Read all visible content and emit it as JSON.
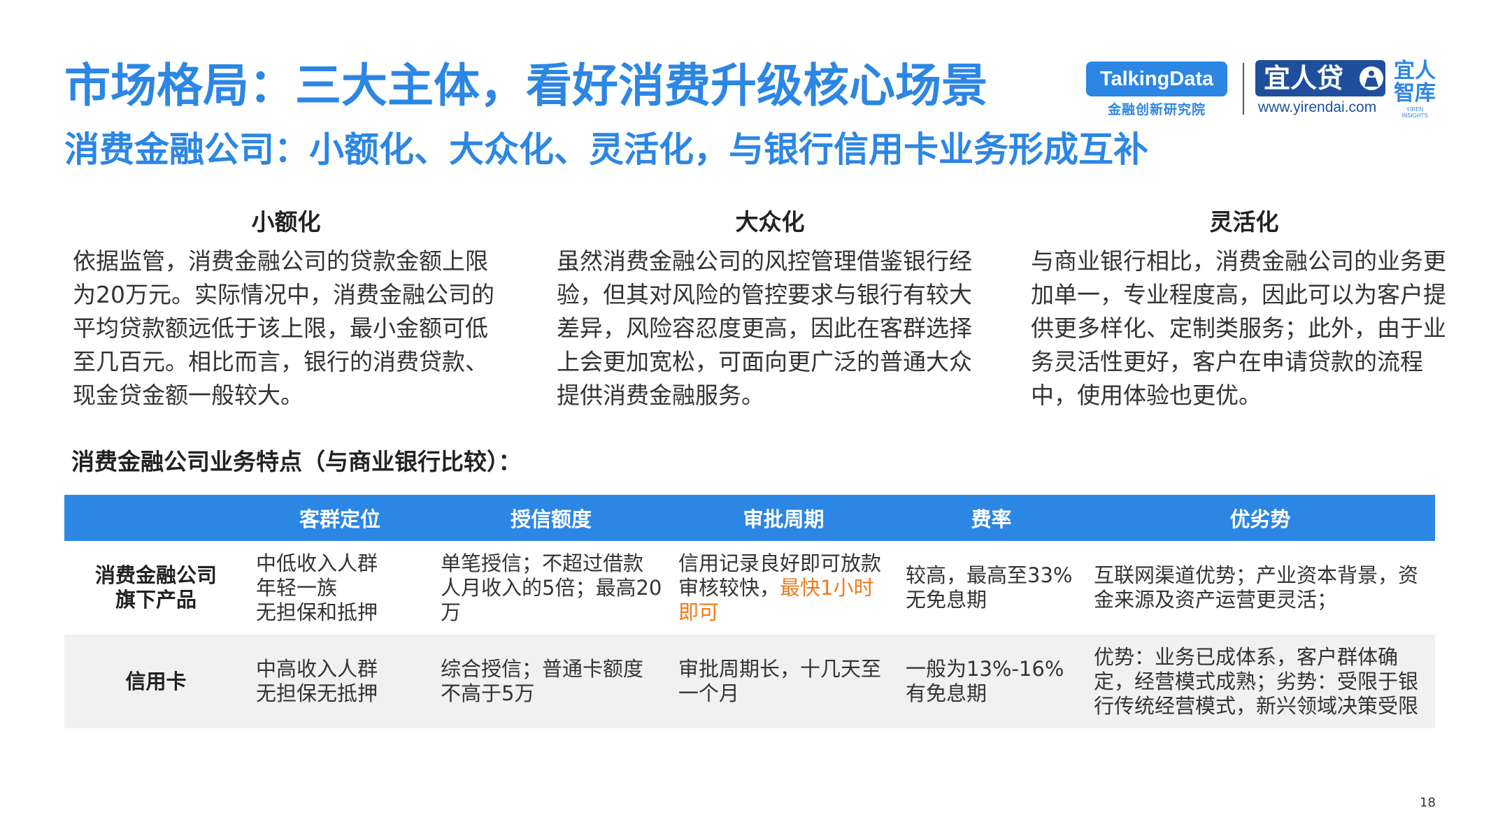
{
  "header": {
    "title": "市场格局：三大主体，看好消费升级核心场景",
    "subtitle": "消费金融公司：小额化、大众化、灵活化，与银行信用卡业务形成互补"
  },
  "logos": {
    "talkingdata": {
      "name": "TalkingData",
      "sub": "金融创新研究院"
    },
    "yirendai": {
      "name": "宜人贷",
      "url": "www.yirendai.com",
      "brand_line1": "宜人",
      "brand_line2": "智库",
      "brand_en_line1": "YIREN",
      "brand_en_line2": "INSIGHTS"
    }
  },
  "columns": [
    {
      "heading": "小额化",
      "body": "依据监管，消费金融公司的贷款金额上限为20万元。实际情况中，消费金融公司的平均贷款额远低于该上限，最小金额可低至几百元。相比而言，银行的消费贷款、现金贷金额一般较大。"
    },
    {
      "heading": "大众化",
      "body": "虽然消费金融公司的风控管理借鉴银行经验，但其对风险的管控要求与银行有较大差异，风险容忍度更高，因此在客群选择上会更加宽松，可面向更广泛的普通大众提供消费金融服务。"
    },
    {
      "heading": "灵活化",
      "body": "与商业银行相比，消费金融公司的业务更加单一，专业程度高，因此可以为客户提供更多样化、定制类服务；此外，由于业务灵活性更好，客户在申请贷款的流程中，使用体验也更优。"
    }
  ],
  "section_label": "消费金融公司业务特点（与商业银行比较）：",
  "table": {
    "headers": [
      "",
      "客群定位",
      "授信额度",
      "审批周期",
      "费率",
      "优劣势"
    ],
    "rows": [
      {
        "name_line1": "消费金融公司",
        "name_line2": "旗下产品",
        "customer": [
          "中低收入人群",
          "年轻一族",
          "无担保和抵押"
        ],
        "credit": "单笔授信；不超过借款人月收入的5倍；最高20万",
        "approval_plain": "信用记录良好即可放款审核较快，",
        "approval_highlight": "最快1小时即可",
        "rate": [
          "较高，最高至33%",
          "无免息期"
        ],
        "pros_cons": "互联网渠道优势；产业资本背景，资金来源及资产运营更灵活；"
      },
      {
        "name_line1": "信用卡",
        "customer": [
          "中高收入人群",
          "无担保无抵押"
        ],
        "credit": "综合授信；普通卡额度不高于5万",
        "approval": "审批周期长，十几天至一个月",
        "rate": [
          "一般为13%-16%",
          "有免息期"
        ],
        "pros_cons": "优势：业务已成体系，客户群体确定，经营模式成熟；劣势：受限于银行传统经营模式，新兴领域决策受限"
      }
    ]
  },
  "page_number": "18",
  "colors": {
    "accent": "#2c86e4",
    "highlight": "#f07b1b",
    "yirendai_navy": "#1f4f9c",
    "row_alt": "#f1f1f1"
  }
}
